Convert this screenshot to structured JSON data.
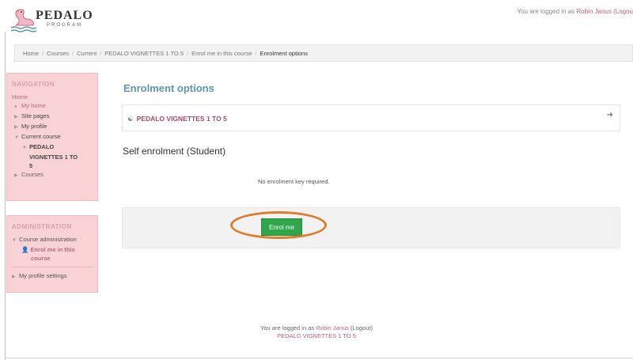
{
  "header": {
    "logo_text": "PEDALO",
    "logo_subtext": "PROGRAM",
    "login_prefix": "You are logged in as ",
    "login_user": "Robin Janus",
    "login_logout": " (Logou"
  },
  "breadcrumb": [
    "Home",
    "Courses",
    "Current",
    "PEDALO VIGNETTES 1 TO 5",
    "Enrol me in this course",
    "Enrolment options"
  ],
  "navigation": {
    "title": "NAVIGATION",
    "items": {
      "home": "Home",
      "my_home": "My home",
      "site_pages": "Site pages",
      "my_profile": "My profile",
      "current_course": "Current course",
      "course_line1": "PEDALO",
      "course_line2": "VIGNETTES 1 TO",
      "course_line3": "5",
      "courses": "Courses"
    }
  },
  "administration": {
    "title": "ADMINISTRATION",
    "course_admin": "Course administration",
    "enrol_line1": "Enrol me in this",
    "enrol_line2": "course",
    "profile_settings": "My profile settings"
  },
  "main": {
    "page_title": "Enrolment options",
    "course_name": "PEDALO VIGNETTES 1 TO 5",
    "section_title": "Self enrolment (Student)",
    "no_key_text": "No enrolment key required.",
    "enrol_button": "Enrol me"
  },
  "footer": {
    "login_prefix": "You are logged in as ",
    "login_user": "Robin Janus",
    "logout": " (Logout)",
    "course": "PEDALO VIGNETTES 1 TO 5"
  },
  "colors": {
    "accent": "#5b97a6",
    "block_bg": "#f9d2d5",
    "button": "#2fa64a",
    "highlight": "#e07a2c"
  }
}
